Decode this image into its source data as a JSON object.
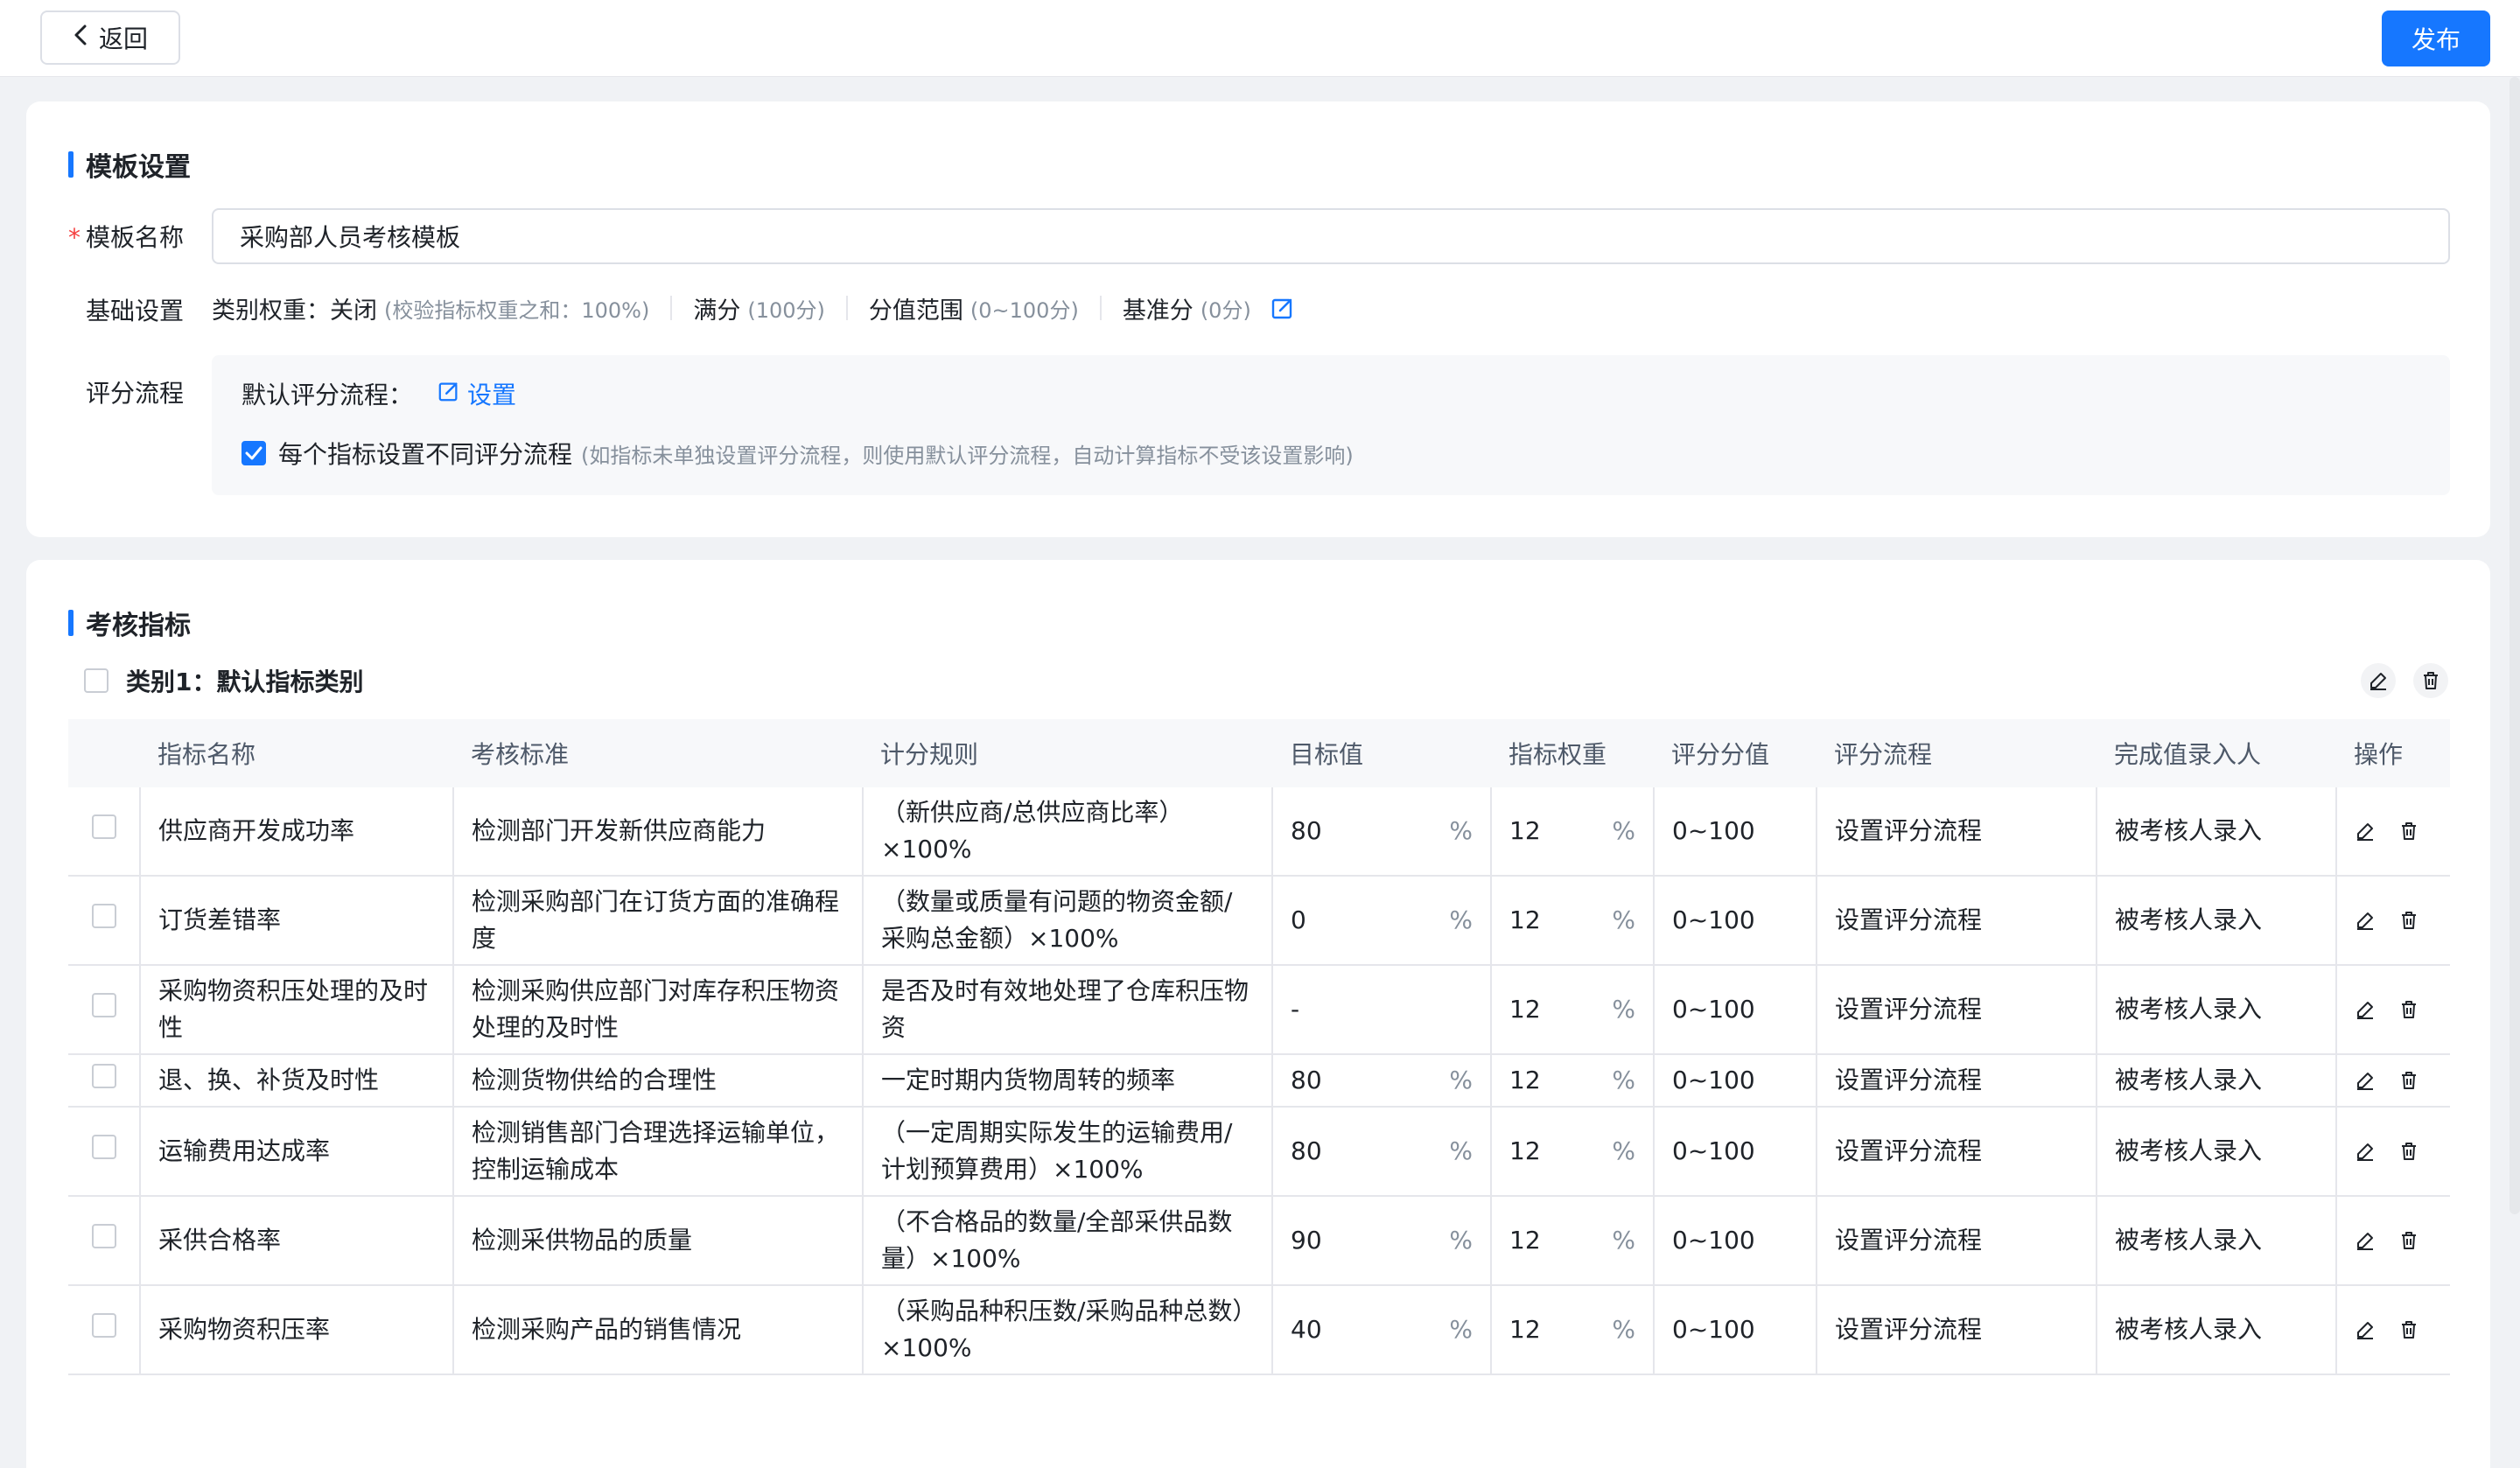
{
  "header": {
    "back_label": "返回",
    "publish_label": "发布"
  },
  "template_settings": {
    "title": "模板设置",
    "name_label": "模板名称",
    "required_mark": "*",
    "name_value": "采购部人员考核模板",
    "basic_label": "基础设置",
    "category_weight_label": "类别权重：",
    "category_weight_value": "关闭",
    "category_weight_hint": "(校验指标权重之和：100%)",
    "full_score_label": "满分",
    "full_score_hint": "(100分)",
    "score_range_label": "分值范围",
    "score_range_hint": "(0~100分)",
    "base_score_label": "基准分",
    "base_score_hint": "(0分)",
    "flow_label": "评分流程",
    "default_flow_label": "默认评分流程：",
    "default_flow_link": "设置",
    "per_metric_label": "每个指标设置不同评分流程",
    "per_metric_checked": true,
    "per_metric_hint": "(如指标未单独设置评分流程，则使用默认评分流程，自动计算指标不受该设置影响)"
  },
  "metrics": {
    "title": "考核指标",
    "category_label": "类别1：默认指标类别",
    "columns": [
      "指标名称",
      "考核标准",
      "计分规则",
      "目标值",
      "指标权重",
      "评分分值",
      "评分流程",
      "完成值录入人",
      "操作"
    ],
    "rows": [
      {
        "name": "供应商开发成功率",
        "standard": "检测部门开发新供应商能力",
        "rule": "（新供应商/总供应商比率）×100%",
        "target": "80",
        "target_unit": "%",
        "weight": "12",
        "weight_unit": "%",
        "score": "0~100",
        "flow": "设置评分流程",
        "entry": "被考核人录入"
      },
      {
        "name": "订货差错率",
        "standard": "检测采购部门在订货方面的准确程度",
        "rule": "（数量或质量有问题的物资金额/采购总金额）×100%",
        "target": "0",
        "target_unit": "%",
        "weight": "12",
        "weight_unit": "%",
        "score": "0~100",
        "flow": "设置评分流程",
        "entry": "被考核人录入"
      },
      {
        "name": "采购物资积压处理的及时性",
        "standard": "检测采购供应部门对库存积压物资处理的及时性",
        "rule": "是否及时有效地处理了仓库积压物资",
        "target": "-",
        "target_unit": "",
        "weight": "12",
        "weight_unit": "%",
        "score": "0~100",
        "flow": "设置评分流程",
        "entry": "被考核人录入"
      },
      {
        "name": "退、换、补货及时性",
        "standard": "检测货物供给的合理性",
        "rule": "一定时期内货物周转的频率",
        "target": "80",
        "target_unit": "%",
        "weight": "12",
        "weight_unit": "%",
        "score": "0~100",
        "flow": "设置评分流程",
        "entry": "被考核人录入"
      },
      {
        "name": "运输费用达成率",
        "standard": "检测销售部门合理选择运输单位，控制运输成本",
        "rule": "（一定周期实际发生的运输费用/计划预算费用）×100%",
        "target": "80",
        "target_unit": "%",
        "weight": "12",
        "weight_unit": "%",
        "score": "0~100",
        "flow": "设置评分流程",
        "entry": "被考核人录入"
      },
      {
        "name": "采供合格率",
        "standard": "检测采供物品的质量",
        "rule": "（不合格品的数量/全部采供品数量）×100%",
        "target": "90",
        "target_unit": "%",
        "weight": "12",
        "weight_unit": "%",
        "score": "0~100",
        "flow": "设置评分流程",
        "entry": "被考核人录入"
      },
      {
        "name": "采购物资积压率",
        "standard": "检测采购产品的销售情况",
        "rule": "（采购品种积压数/采购品种总数）×100%",
        "target": "40",
        "target_unit": "%",
        "weight": "12",
        "weight_unit": "%",
        "score": "0~100",
        "flow": "设置评分流程",
        "entry": "被考核人录入"
      }
    ]
  },
  "colors": {
    "primary": "#1677ff",
    "required": "#f53f3f",
    "hint": "#86909c"
  }
}
